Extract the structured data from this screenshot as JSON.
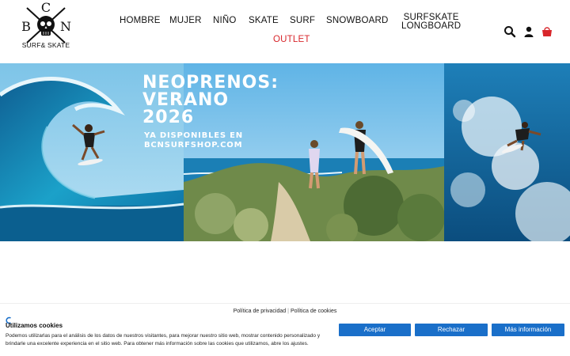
{
  "header": {
    "logo": {
      "letters": [
        "C",
        "B",
        "N"
      ],
      "tagline": "SURF& SKATE"
    },
    "nav": [
      {
        "label": "HOMBRE"
      },
      {
        "label": "MUJER"
      },
      {
        "label": "NIÑO"
      },
      {
        "label": "SKATE"
      },
      {
        "label": "SURF"
      },
      {
        "label": "SNOWBOARD"
      },
      {
        "label_line1": "SURFSKATE",
        "label_line2": "LONGBOARD"
      }
    ],
    "outlet": "OUTLET",
    "icons": [
      "search-icon",
      "user-icon",
      "cart-icon"
    ],
    "accent_color": "#d8262b"
  },
  "hero": {
    "title_lines": [
      "NEOPRENOS:",
      "VERANO",
      "2026"
    ],
    "subtitle_lines": [
      "YA DISPONIBLES EN",
      "BCNSURFSHOP.COM"
    ]
  },
  "cookie_banner": {
    "links": {
      "privacy": "Política de privacidad",
      "cookies": "Política de cookies"
    },
    "title": "Utilizamos cookies",
    "body": "Podemos utilizarlas para el análisis de los datos de nuestros visitantes, para mejorar nuestro sitio web, mostrar contenido personalizado y brindarle una excelente experiencia en el sitio web. Para obtener más información sobre las cookies que utilizamos, abre los ajustes.",
    "buttons": {
      "accept": "Aceptar",
      "reject": "Rechazar",
      "more": "Más información"
    },
    "button_color": "#1a6fc9"
  }
}
